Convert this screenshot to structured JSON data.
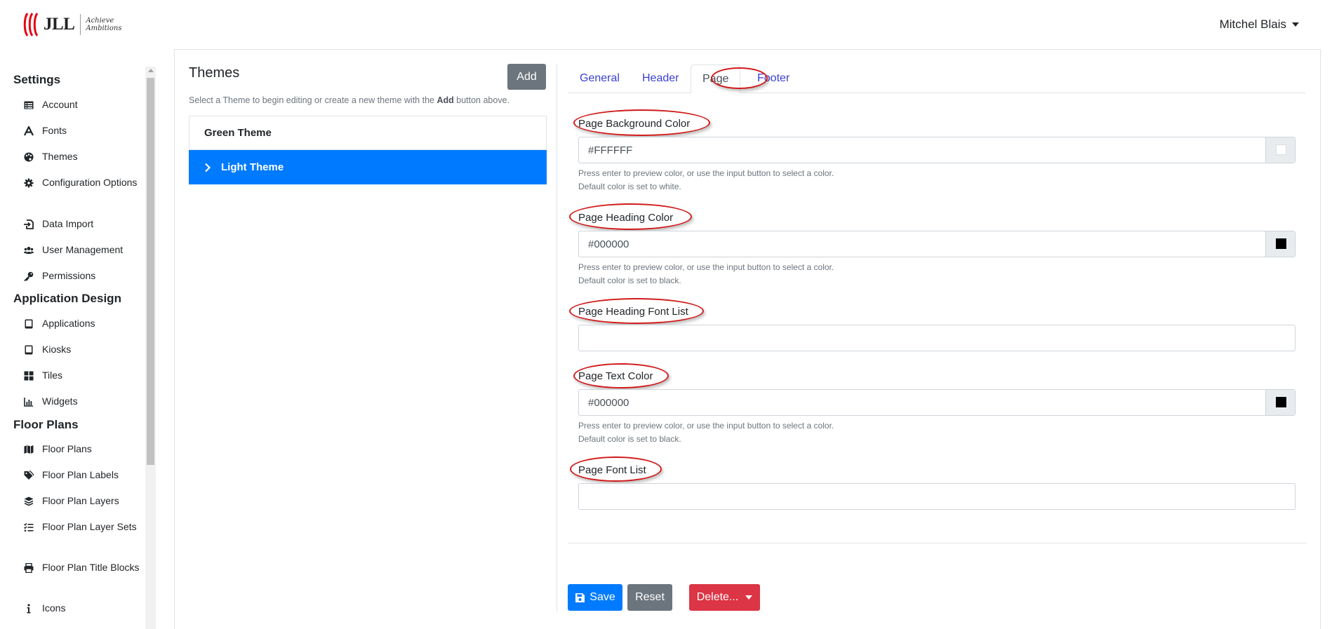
{
  "brand": {
    "name": "JLL",
    "tagline_line1": "Achieve",
    "tagline_line2": "Ambitions"
  },
  "user": {
    "name": "Mitchel Blais"
  },
  "sidebar": {
    "sections": [
      {
        "title": "Settings",
        "items": [
          {
            "label": "Account",
            "icon": "list-icon"
          },
          {
            "label": "Fonts",
            "icon": "font-icon"
          },
          {
            "label": "Themes",
            "icon": "palette-icon"
          },
          {
            "label": "Configuration Options",
            "icon": "gear-icon"
          },
          {
            "label": "Data Import",
            "icon": "file-import-icon"
          },
          {
            "label": "User Management",
            "icon": "users-icon"
          },
          {
            "label": "Permissions",
            "icon": "key-icon"
          }
        ]
      },
      {
        "title": "Application Design",
        "items": [
          {
            "label": "Applications",
            "icon": "tablet-icon"
          },
          {
            "label": "Kiosks",
            "icon": "tablet-icon"
          },
          {
            "label": "Tiles",
            "icon": "grid-icon"
          },
          {
            "label": "Widgets",
            "icon": "chart-icon"
          }
        ]
      },
      {
        "title": "Floor Plans",
        "items": [
          {
            "label": "Floor Plans",
            "icon": "map-icon"
          },
          {
            "label": "Floor Plan Labels",
            "icon": "tags-icon"
          },
          {
            "label": "Floor Plan Layers",
            "icon": "layers-icon"
          },
          {
            "label": "Floor Plan Layer Sets",
            "icon": "tasks-icon"
          },
          {
            "label": "Floor Plan Title Blocks",
            "icon": "print-icon"
          },
          {
            "label": "Icons",
            "icon": "info-icon"
          }
        ]
      }
    ]
  },
  "themes": {
    "title": "Themes",
    "add_label": "Add",
    "help_prefix": "Select a Theme to begin editing or create a new theme with the ",
    "help_bold": "Add",
    "help_suffix": " button above.",
    "list": [
      {
        "name": "Green Theme",
        "active": false
      },
      {
        "name": "Light Theme",
        "active": true
      }
    ]
  },
  "tabs": [
    {
      "label": "General",
      "active": false
    },
    {
      "label": "Header",
      "active": false
    },
    {
      "label": "Page",
      "active": true
    },
    {
      "label": "Footer",
      "active": false
    }
  ],
  "form": {
    "page_bg": {
      "label": "Page Background Color",
      "value": "#FFFFFF",
      "swatch": "#FFFFFF",
      "help1": "Press enter to preview color, or use the input button to select a color.",
      "help2": "Default color is set to white."
    },
    "heading_color": {
      "label": "Page Heading Color",
      "value": "#000000",
      "swatch": "#000000",
      "help1": "Press enter to preview color, or use the input button to select a color.",
      "help2": "Default color is set to black."
    },
    "heading_font": {
      "label": "Page Heading Font List",
      "value": ""
    },
    "text_color": {
      "label": "Page Text Color",
      "value": "#000000",
      "swatch": "#000000",
      "help1": "Press enter to preview color, or use the input button to select a color.",
      "help2": "Default color is set to black."
    },
    "font_list": {
      "label": "Page Font List",
      "value": ""
    }
  },
  "actions": {
    "save": "Save",
    "reset": "Reset",
    "delete": "Delete..."
  },
  "colors": {
    "primary": "#007bff",
    "secondary": "#6c757d",
    "danger": "#dc3545",
    "annotation": "#d11a1a",
    "brand_red": "#e30613"
  }
}
